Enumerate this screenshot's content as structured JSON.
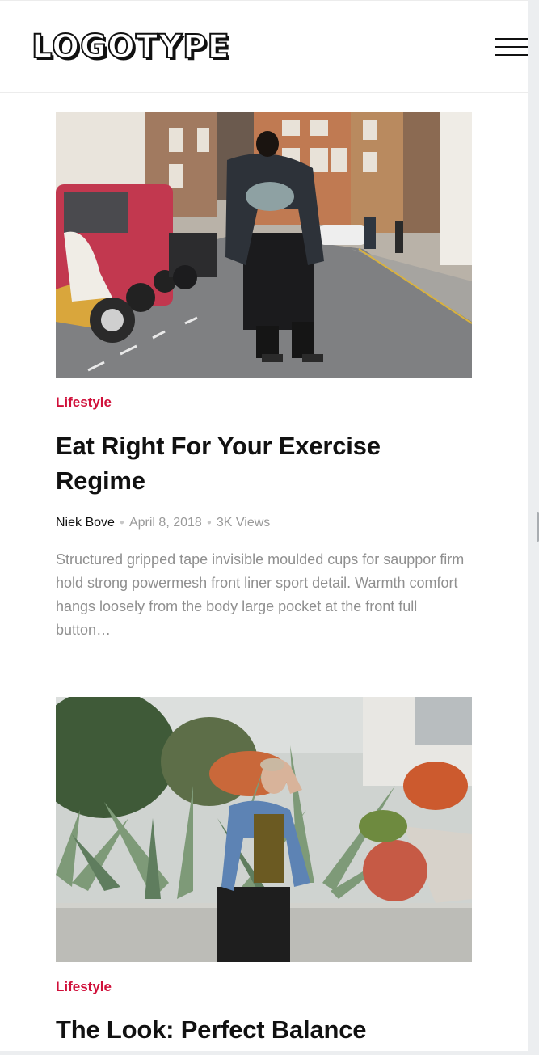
{
  "header": {
    "logo_text": "LOGOTYPE",
    "menu_icon": "hamburger-menu-icon"
  },
  "posts": [
    {
      "category": "Lifestyle",
      "title": "Eat Right For Your Exercise Regime",
      "author": "Niek Bove",
      "date": "April 8, 2018",
      "views": "3K Views",
      "excerpt": "Structured gripped tape invisible moulded cups for sauppor firm hold strong powermesh front liner sport detail. Warmth comfort hangs loosely from the body large pocket at the front full button…"
    },
    {
      "category": "Lifestyle",
      "title": "The Look: Perfect Balance"
    }
  ],
  "colors": {
    "accent": "#d0103a",
    "text": "#111111",
    "muted": "#8f8f8f"
  }
}
